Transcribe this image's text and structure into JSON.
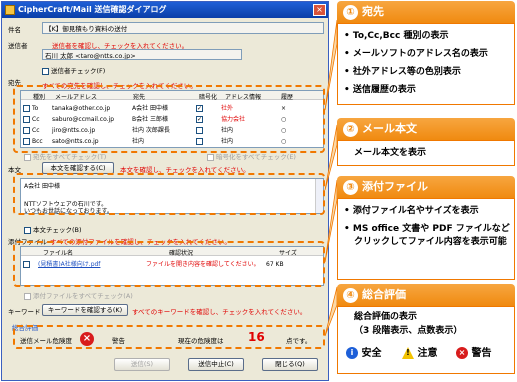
{
  "window": {
    "title": "CipherCraft/Mail 送信確認ダイアログ",
    "close": "×"
  },
  "subject": {
    "label": "件名",
    "value": "【K】御見積もり資料の送付"
  },
  "sender": {
    "label": "送信者",
    "warning": "送信者を確認し、チェックを入れてください。",
    "value": "石川 太郎 <taro@ntts.co.jp>",
    "check_label": "送信者チェック(F)"
  },
  "recipients": {
    "label": "宛先",
    "warning": "すべての宛先を確認し、チェックを入れてください。",
    "headers": [
      "種別",
      "メールアドレス",
      "宛先",
      "暗号化",
      "アドレス情報",
      "履歴"
    ],
    "rows": [
      {
        "type": "To",
        "address": "tanaka@other.co.jp",
        "name": "A会社 田中様",
        "info": "社外",
        "history": "×"
      },
      {
        "type": "Cc",
        "address": "saburo@ccmail.co.jp",
        "name": "B会社 三郎様",
        "info": "協力会社",
        "history": "○"
      },
      {
        "type": "Cc",
        "address": "jiro@ntts.co.jp",
        "name": "社内 次郎課長",
        "info": "社内",
        "history": "○"
      },
      {
        "type": "Bcc",
        "address": "sato@ntts.co.jp",
        "name": "社内",
        "info": "社内",
        "history": "○"
      }
    ],
    "check_all": "宛先をすべてチェック(T)",
    "enc_all": "暗号化をすべてチェック(E)"
  },
  "body": {
    "label": "本文",
    "confirm_button": "本文を確認する(C)",
    "warning": "本文を確認し、チェックを入れてください。",
    "line1": "A会社 田中様",
    "line2": "NTTソフトウェアの石川です。",
    "line3": "いつもお世話になっております。",
    "check_label": "本文チェック(B)"
  },
  "attachments": {
    "label": "添付ファイル",
    "warning": "すべての添付ファイルを確認し、チェックを入れてください。",
    "headers": [
      "ファイル名",
      "確認状況",
      "サイズ"
    ],
    "rows": [
      {
        "name": "(見積書)A社様向け.pdf",
        "status": "ファイルを開き内容を確認してください。",
        "size": "67 KB"
      }
    ],
    "check_all": "添付ファイルをすべてチェック(A)"
  },
  "keyword": {
    "label": "キーワード",
    "button": "キーワードを確認する(K)",
    "warning": "すべてのキーワードを確認し、チェックを入れてください。"
  },
  "evaluation": {
    "legend": "総合評価",
    "risk_label": "送信メール危険度",
    "level": "警告",
    "score_label": "現在の危険度は",
    "score": "16",
    "score_unit": "点です。"
  },
  "buttons": {
    "send": "送信(S)",
    "send_cancel": "送信中止(C)",
    "close": "閉じる(Q)"
  },
  "callouts": [
    {
      "number": "①",
      "title": "宛先",
      "items": [
        "To,Cc,Bcc 種別の表示",
        "メールソフトのアドレス名の表示",
        "社外アドレス等の色別表示",
        "送信履歴の表示"
      ]
    },
    {
      "number": "②",
      "title": "メール本文",
      "items": [
        "メール本文を表示"
      ]
    },
    {
      "number": "③",
      "title": "添付ファイル",
      "items": [
        "添付ファイル名やサイズを表示",
        "MS office 文書や PDF ファイルなどクリックしてファイル内容を表示可能"
      ]
    },
    {
      "number": "④",
      "title": "総合評価",
      "items": [
        "総合評価の表示",
        "（3 段階表示、点数表示）"
      ],
      "legend": [
        {
          "icon": "i",
          "label": "安全",
          "color": "#1d5fd8"
        },
        {
          "icon": "!",
          "label": "注意",
          "color": "#f3c300"
        },
        {
          "icon": "×",
          "label": "警告",
          "color": "#d81c1c"
        }
      ]
    }
  ]
}
